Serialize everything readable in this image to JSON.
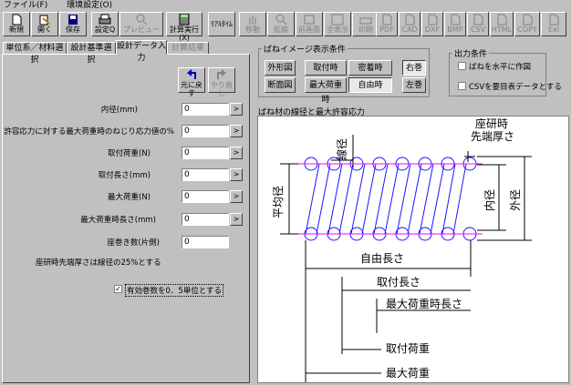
{
  "menu": [
    "ファイル(F)",
    "環境設定(O)"
  ],
  "toolbar": {
    "new": "新規",
    "open": "開く",
    "save": "保存",
    "settings": "設定Q",
    "preview": "プレビュー",
    "calc": "計算実行(X)",
    "realtime": "ﾘｱﾙﾀｲﾑ",
    "move": "移動",
    "zoom": "拡縮",
    "prev_view": "前画面",
    "full_view": "全表示",
    "print": "印刷",
    "pdf": "PDF",
    "cad": "CAD",
    "dxf": "DXF",
    "bmp": "BMP",
    "csv": "CSV",
    "html": "HTML",
    "copy": "COPY",
    "xls": "Exl"
  },
  "tabs": [
    "単位系／材料選択",
    "設計基準選択",
    "設計データ入力",
    "計算結果"
  ],
  "buttons": {
    "undo": "元に戻す",
    "redo": "やり直し"
  },
  "fields": [
    {
      "label": "内径(mm)",
      "value": "0"
    },
    {
      "label": "許容応力に対する最大荷重時のねじり応力値の%",
      "value": "0"
    },
    {
      "label": "取付荷重(N)",
      "value": "0"
    },
    {
      "label": "取付長さ(mm)",
      "value": "0"
    },
    {
      "label": "最大荷重(N)",
      "value": "0"
    },
    {
      "label": "最大荷重時長さ(mm)",
      "value": "0"
    },
    {
      "label": "座巻き数(片側)",
      "value": "0"
    }
  ],
  "note": "座研時先端厚さは線径の25%とする",
  "checkbox_effective": "有効巻数を0．5単位とする",
  "spring_view": {
    "title": "ばねイメージ表示条件",
    "buttons": [
      "外形図",
      "断面図",
      "取付時",
      "最大荷重時",
      "密着時",
      "自由時",
      "右巻",
      "左巻"
    ]
  },
  "output": {
    "title": "出力条件",
    "horizontal": "ばねを水平に作図",
    "csv": "CSVを要目表データとする"
  },
  "diagram": {
    "title": "ばね材の線径と最大許容応力",
    "labels": {
      "grind1": "座研時",
      "grind2": "先端厚さ",
      "wire": "線径",
      "mean": "平均径",
      "inner": "内径",
      "outer": "外径",
      "free": "自由長さ",
      "install": "取付長さ",
      "maxlen": "最大荷重時長さ",
      "installload": "取付荷重",
      "maxload": "最大荷重"
    },
    "colors": {
      "coil": "#1818ff",
      "centerline": "#ff00ff"
    }
  }
}
